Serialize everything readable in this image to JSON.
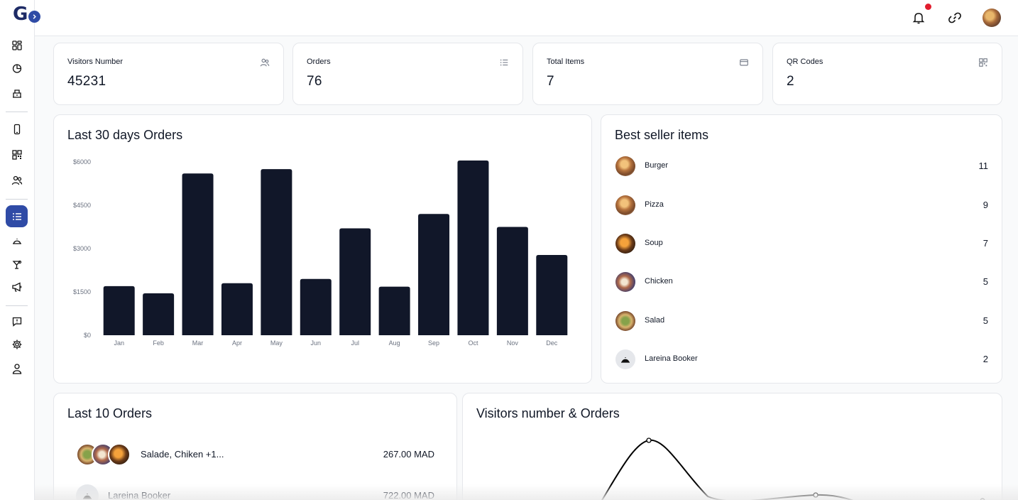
{
  "app": {
    "logo_letter": "G"
  },
  "sidebar": {
    "items": [
      {
        "icon": "dashboard-icon"
      },
      {
        "icon": "pie-chart-icon"
      },
      {
        "icon": "store-icon"
      },
      {
        "icon": "mobile-icon"
      },
      {
        "icon": "qr-code-icon"
      },
      {
        "icon": "users-icon"
      },
      {
        "icon": "list-icon",
        "active": true
      },
      {
        "icon": "cloche-icon"
      },
      {
        "icon": "cocktail-icon"
      },
      {
        "icon": "megaphone-icon"
      },
      {
        "icon": "feedback-icon"
      },
      {
        "icon": "settings-icon"
      },
      {
        "icon": "user-icon"
      }
    ]
  },
  "stats": [
    {
      "label": "Visitors Number",
      "value": "45231",
      "icon": "users-icon"
    },
    {
      "label": "Orders",
      "value": "76",
      "icon": "list-icon"
    },
    {
      "label": "Total Items",
      "value": "7",
      "icon": "card-icon"
    },
    {
      "label": "QR Codes",
      "value": "2",
      "icon": "qr-code-icon"
    }
  ],
  "orders_chart": {
    "title": "Last 30 days Orders"
  },
  "chart_data": [
    {
      "type": "bar",
      "categories": [
        "Jan",
        "Feb",
        "Mar",
        "Apr",
        "May",
        "Jun",
        "Jul",
        "Aug",
        "Sep",
        "Oct",
        "Nov",
        "Dec"
      ],
      "values": [
        1700,
        1450,
        5600,
        1800,
        5750,
        1950,
        3700,
        1680,
        4200,
        6050,
        3750,
        2780
      ],
      "ylim": [
        0,
        6000
      ],
      "yticks": [
        0,
        1500,
        3000,
        4500,
        6000
      ],
      "ytick_labels": [
        "$0",
        "$1500",
        "$3000",
        "$4500",
        "$6000"
      ],
      "bar_color": "#111729",
      "grid": false
    },
    {
      "type": "line",
      "title": "Visitors number & Orders",
      "points_visible": 3,
      "line_color": "#000000"
    }
  ],
  "best_sellers": {
    "title": "Best seller items",
    "items": [
      {
        "name": "Burger",
        "count": "11",
        "img": "a"
      },
      {
        "name": "Pizza",
        "count": "9",
        "img": "a"
      },
      {
        "name": "Soup",
        "count": "7",
        "img": "b"
      },
      {
        "name": "Chicken",
        "count": "5",
        "img": "c"
      },
      {
        "name": "Salad",
        "count": "5",
        "img": "d"
      },
      {
        "name": "Lareina Booker",
        "count": "2",
        "img": "plate"
      }
    ]
  },
  "last_orders": {
    "title": "Last 10 Orders",
    "rows": [
      {
        "items": "Salade, Chiken  +1...",
        "amount": "267.00 MAD"
      },
      {
        "items": "Lareina Booker",
        "amount": "722.00 MAD"
      }
    ]
  },
  "visitors_chart": {
    "title": "Visitors number & Orders"
  }
}
